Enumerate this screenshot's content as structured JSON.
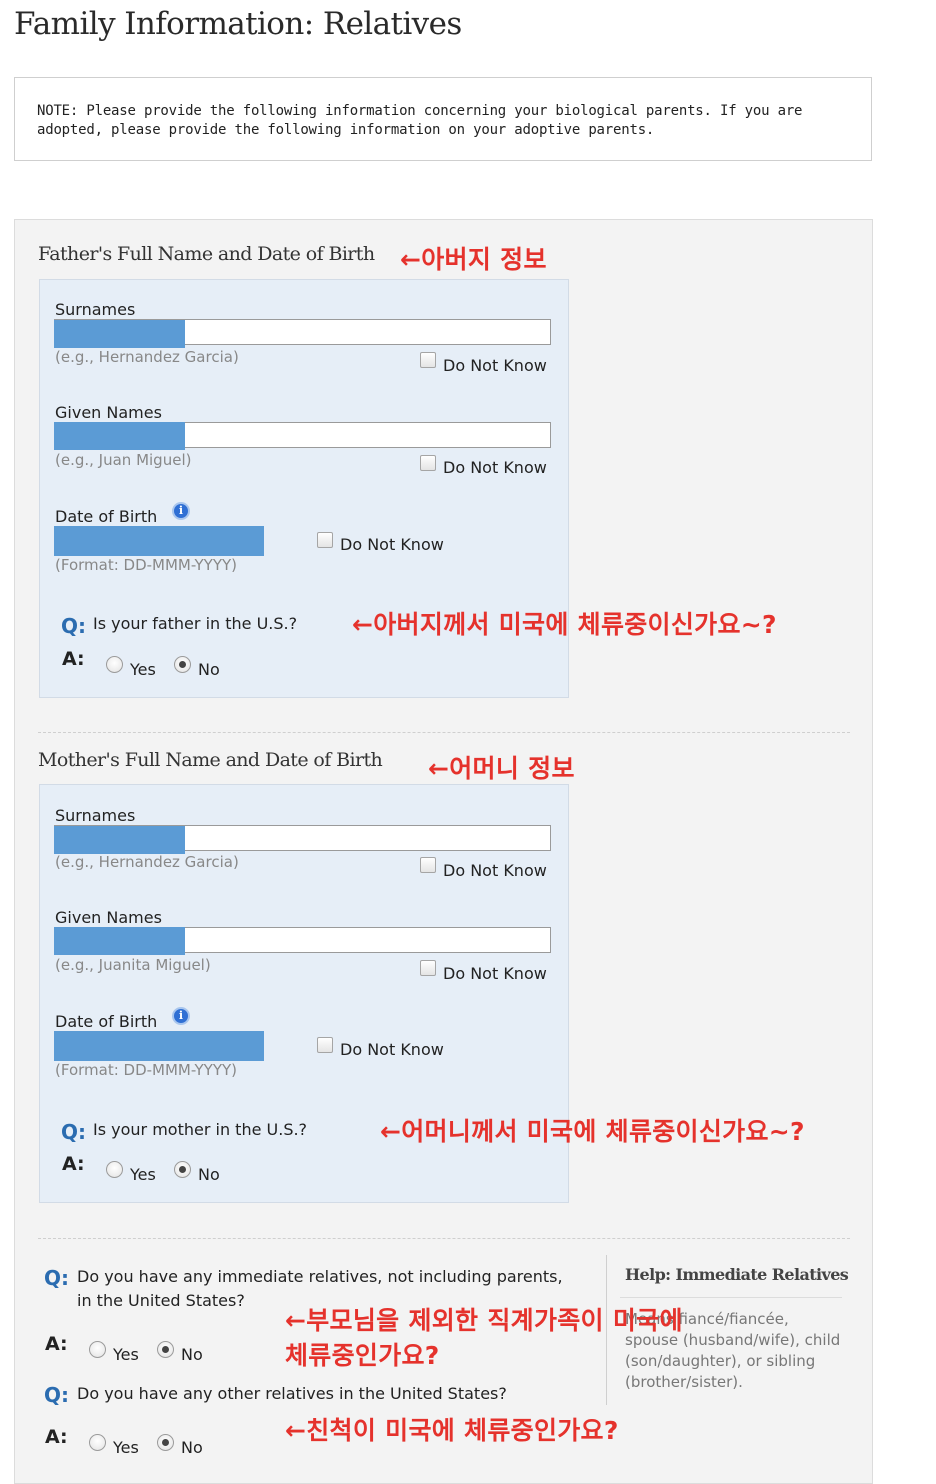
{
  "page": {
    "title": "Family Information: Relatives",
    "note": "NOTE: Please provide the following information concerning your biological parents. If you are adopted, please provide the following information on your adoptive parents."
  },
  "father": {
    "section_title": "Father's Full Name and Date of Birth",
    "annotation": "←아버지 정보",
    "surnames": {
      "label": "Surnames",
      "hint": "(e.g., Hernandez Garcia)",
      "dnk": "Do Not Know"
    },
    "given": {
      "label": "Given Names",
      "hint": "(e.g., Juan Miguel)",
      "dnk": "Do Not Know"
    },
    "dob": {
      "label": "Date of Birth",
      "hint": "(Format: DD-MMM-YYYY)",
      "dnk": "Do Not Know"
    },
    "question": {
      "q": "Q:",
      "text": "Is your father in the U.S.?",
      "a": "A:",
      "yes": "Yes",
      "no": "No",
      "selected": "No"
    },
    "q_annotation": "←아버지께서 미국에 체류중이신가요~?"
  },
  "mother": {
    "section_title": "Mother's Full Name and Date of Birth",
    "annotation": "←어머니 정보",
    "surnames": {
      "label": "Surnames",
      "hint": "(e.g., Hernandez Garcia)",
      "dnk": "Do Not Know"
    },
    "given": {
      "label": "Given Names",
      "hint": "(e.g., Juanita Miguel)",
      "dnk": "Do Not Know"
    },
    "dob": {
      "label": "Date of Birth",
      "hint": "(Format: DD-MMM-YYYY)",
      "dnk": "Do Not Know"
    },
    "question": {
      "q": "Q:",
      "text": "Is your mother in the U.S.?",
      "a": "A:",
      "yes": "Yes",
      "no": "No",
      "selected": "No"
    },
    "q_annotation": "←어머니께서 미국에 체류중이신가요~?"
  },
  "relatives": {
    "q1": {
      "q": "Q:",
      "line1": "Do you have any immediate relatives, not including parents,",
      "line2": "in the United States?",
      "a": "A:",
      "yes": "Yes",
      "no": "No",
      "selected": "No"
    },
    "q1_annotation_line1": "←부모님을 제외한 직계가족이 미국에",
    "q1_annotation_line2": "체류중인가요?",
    "q2": {
      "q": "Q:",
      "text": "Do you have any other relatives in the United States?",
      "a": "A:",
      "yes": "Yes",
      "no": "No",
      "selected": "No"
    },
    "q2_annotation": "←친척이 미국에 체류중인가요?",
    "help": {
      "title": "Help: Immediate Relatives",
      "text": "Means fiancé/fiancée, spouse (husband/wife), child (son/daughter), or sibling (brother/sister)."
    }
  },
  "colors": {
    "annotation": "#e5322c",
    "panel": "#e6eef7",
    "redaction": "#5b9bd5",
    "q_mark": "#2b6cb0"
  }
}
